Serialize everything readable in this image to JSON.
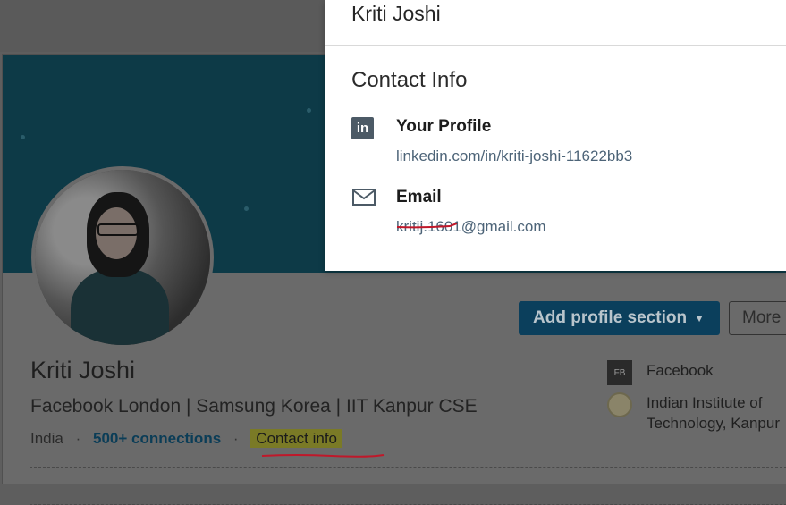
{
  "profile": {
    "name": "Kriti Joshi",
    "headline": "Facebook London | Samsung Korea | IIT Kanpur CSE",
    "location": "India",
    "connections": "500+ connections",
    "contact_info_link": "Contact info",
    "add_section_label": "Add profile section",
    "more_label": "More",
    "experience": [
      {
        "icon": "facebook-logo-icon",
        "badge": "FB",
        "label": "Facebook"
      },
      {
        "icon": "iit-seal-icon",
        "label": "Indian Institute of Technology, Kanpur",
        "line1": "Indian Institute of",
        "line2": "Technology, Kanpur"
      }
    ]
  },
  "modal": {
    "name": "Kriti Joshi",
    "section_title": "Contact Info",
    "items": [
      {
        "icon": "linkedin-icon",
        "icon_glyph": "in",
        "title": "Your Profile",
        "value": "linkedin.com/in/kriti-joshi-11622bb3"
      },
      {
        "icon": "envelope-icon",
        "title": "Email",
        "value": "kritij.1601@gmail.com"
      }
    ]
  },
  "colors": {
    "overlay_dim": "#5e5e5e",
    "banner": "#0d3a47",
    "link": "#4d6478",
    "annotation_red": "#c0182a",
    "highlight": "#7a7a26"
  }
}
